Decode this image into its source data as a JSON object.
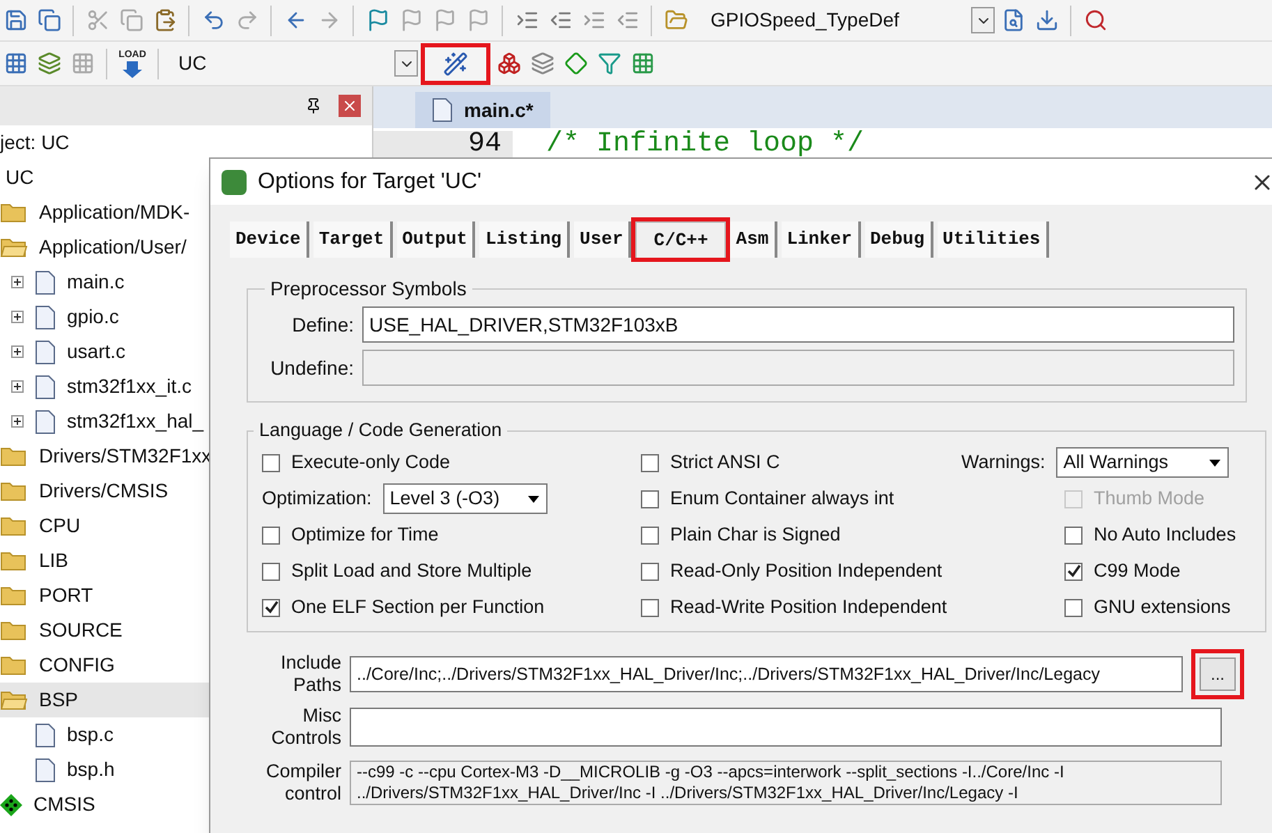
{
  "toolbar1": {
    "combo": "GPIOSpeed_TypeDef"
  },
  "toolbar2": {
    "load_label": "LOAD",
    "target": "UC",
    "wand_highlighted": true
  },
  "project": {
    "header": "ject: UC",
    "root": "UC",
    "items": [
      {
        "label": "Application/MDK-",
        "kind": "folder",
        "open": false,
        "selected": false
      },
      {
        "label": "Application/User/",
        "kind": "folder",
        "open": true,
        "selected": false,
        "children": [
          {
            "label": "main.c",
            "expandable": true
          },
          {
            "label": "gpio.c",
            "expandable": true
          },
          {
            "label": "usart.c",
            "expandable": true
          },
          {
            "label": "stm32f1xx_it.c",
            "expandable": true
          },
          {
            "label": "stm32f1xx_hal_",
            "expandable": true
          }
        ]
      },
      {
        "label": "Drivers/STM32F1xx",
        "kind": "folder",
        "open": false,
        "selected": false
      },
      {
        "label": "Drivers/CMSIS",
        "kind": "folder",
        "open": false,
        "selected": false
      },
      {
        "label": "CPU",
        "kind": "folder",
        "open": false,
        "selected": false
      },
      {
        "label": "LIB",
        "kind": "folder",
        "open": false,
        "selected": false
      },
      {
        "label": "PORT",
        "kind": "folder",
        "open": false,
        "selected": false
      },
      {
        "label": "SOURCE",
        "kind": "folder",
        "open": false,
        "selected": false
      },
      {
        "label": "CONFIG",
        "kind": "folder",
        "open": false,
        "selected": false
      },
      {
        "label": "BSP",
        "kind": "folder",
        "open": true,
        "selected": true,
        "children": [
          {
            "label": "bsp.c",
            "expandable": false
          },
          {
            "label": "bsp.h",
            "expandable": false
          }
        ]
      },
      {
        "label": "CMSIS",
        "kind": "component",
        "selected": false
      }
    ]
  },
  "editor": {
    "tab": "main.c*",
    "line_number": "94",
    "code": "/* Infinite loop */"
  },
  "dialog": {
    "title": "Options for Target 'UC'",
    "tabs": [
      {
        "label": "Device",
        "selected": false,
        "highlighted": false
      },
      {
        "label": "Target",
        "selected": false,
        "highlighted": false
      },
      {
        "label": "Output",
        "selected": false,
        "highlighted": false
      },
      {
        "label": "Listing",
        "selected": false,
        "highlighted": false
      },
      {
        "label": "User",
        "selected": false,
        "highlighted": false
      },
      {
        "label": "C/C++",
        "selected": true,
        "highlighted": true
      },
      {
        "label": "Asm",
        "selected": false,
        "highlighted": false
      },
      {
        "label": "Linker",
        "selected": false,
        "highlighted": false
      },
      {
        "label": "Debug",
        "selected": false,
        "highlighted": false
      },
      {
        "label": "Utilities",
        "selected": false,
        "highlighted": false
      }
    ],
    "preprocessor": {
      "title": "Preprocessor Symbols",
      "define_label": "Define:",
      "define_value": "USE_HAL_DRIVER,STM32F103xB",
      "undefine_label": "Undefine:"
    },
    "language": {
      "title": "Language / Code Generation",
      "columns": [
        [
          {
            "kind": "checkbox",
            "label": "Execute-only Code",
            "checked": false,
            "disabled": false
          },
          {
            "kind": "select",
            "label": "Optimization:",
            "value": "Level 3 (-O3)"
          },
          {
            "kind": "checkbox",
            "label": "Optimize for Time",
            "checked": false,
            "disabled": false
          },
          {
            "kind": "checkbox",
            "label": "Split Load and Store Multiple",
            "checked": false,
            "disabled": false
          },
          {
            "kind": "checkbox",
            "label": "One ELF Section per Function",
            "checked": true,
            "disabled": false
          }
        ],
        [
          {
            "kind": "checkbox",
            "label": "Strict ANSI C",
            "checked": false,
            "disabled": false
          },
          {
            "kind": "checkbox",
            "label": "Enum Container always int",
            "checked": false,
            "disabled": false
          },
          {
            "kind": "checkbox",
            "label": "Plain Char is Signed",
            "checked": false,
            "disabled": false
          },
          {
            "kind": "checkbox",
            "label": "Read-Only Position Independent",
            "checked": false,
            "disabled": false
          },
          {
            "kind": "checkbox",
            "label": "Read-Write Position Independent",
            "checked": false,
            "disabled": false
          }
        ],
        [
          {
            "kind": "select",
            "label": "Warnings:",
            "value": "All Warnings"
          },
          {
            "kind": "checkbox",
            "label": "Thumb Mode",
            "checked": false,
            "disabled": true
          },
          {
            "kind": "checkbox",
            "label": "No Auto Includes",
            "checked": false,
            "disabled": false
          },
          {
            "kind": "checkbox",
            "label": "C99 Mode",
            "checked": true,
            "disabled": false
          },
          {
            "kind": "checkbox",
            "label": "GNU extensions",
            "checked": false,
            "disabled": false
          }
        ]
      ]
    },
    "include": {
      "label": "Include Paths",
      "value": "../Core/Inc;../Drivers/STM32F1xx_HAL_Driver/Inc;../Drivers/STM32F1xx_HAL_Driver/Inc/Legacy",
      "browse": "...",
      "browse_highlighted": true
    },
    "misc": {
      "label": "Misc Controls"
    },
    "compiler": {
      "label": "Compiler control",
      "lines": [
        "--c99 -c --cpu Cortex-M3 -D__MICROLIB -g -O3 --apcs=interwork --split_sections -I../Core/Inc -I",
        "../Drivers/STM32F1xx_HAL_Driver/Inc -I ../Drivers/STM32F1xx_HAL_Driver/Inc/Legacy -I"
      ]
    }
  }
}
